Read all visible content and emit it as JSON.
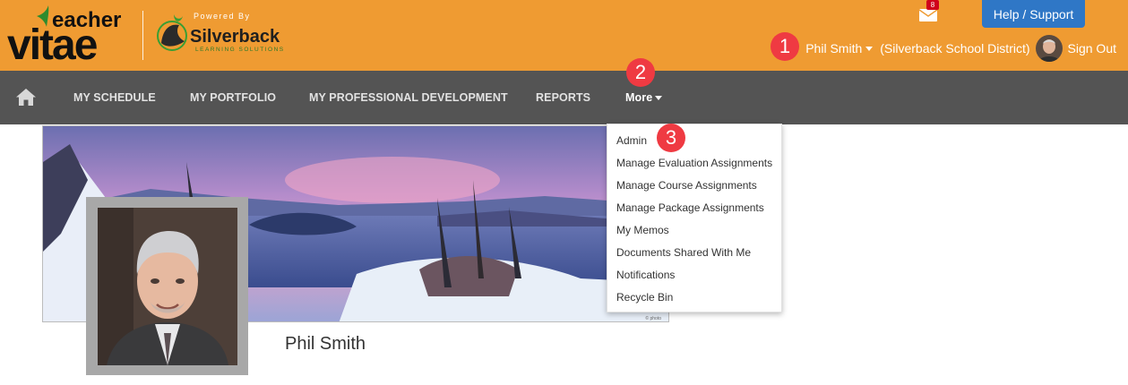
{
  "header": {
    "logo_text": "Teacher Vitae",
    "partner_powered_by": "Powered By",
    "partner_name": "Silverback",
    "partner_tagline": "LEARNING SOLUTIONS",
    "mail_count": "8",
    "help_label": "Help / Support",
    "user_name": "Phil Smith",
    "district": "(Silverback School District)",
    "sign_out": "Sign Out",
    "brand_color": "#ef9b32"
  },
  "nav": {
    "items": [
      "MY SCHEDULE",
      "MY PORTFOLIO",
      "MY PROFESSIONAL DEVELOPMENT",
      "REPORTS"
    ],
    "more_label": "More",
    "bar_color": "#545454"
  },
  "dropdown": {
    "items": [
      "Admin",
      "Manage Evaluation Assignments",
      "Manage Course Assignments",
      "Manage Package Assignments",
      "My Memos",
      "Documents Shared With Me",
      "Notifications",
      "Recycle Bin"
    ]
  },
  "profile": {
    "name": "Phil Smith"
  },
  "callouts": [
    "1",
    "2",
    "3"
  ],
  "icons": {
    "home": "home-icon",
    "mail": "mail-icon",
    "caret": "caret-down-icon"
  }
}
